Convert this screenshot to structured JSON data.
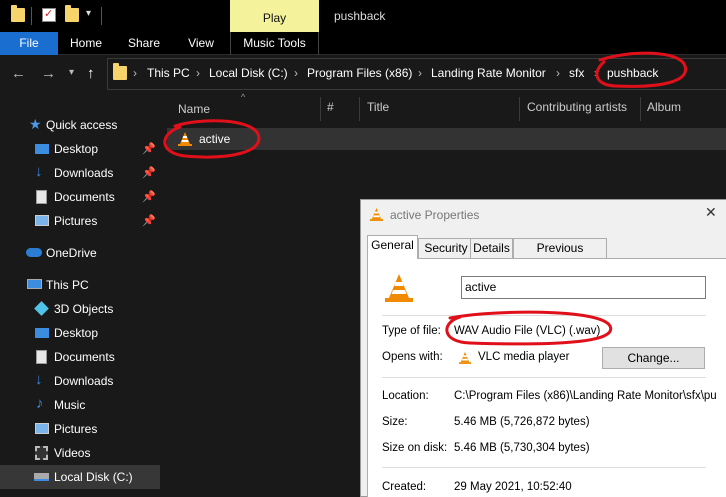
{
  "titlebar": {
    "context_tab": "Play",
    "window_title": "pushback"
  },
  "ribbon": {
    "tabs": [
      "File",
      "Home",
      "Share",
      "View",
      "Music Tools"
    ]
  },
  "address": {
    "crumbs": [
      "This PC",
      "Local Disk (C:)",
      "Program Files (x86)",
      "Landing Rate Monitor",
      "sfx",
      "pushback"
    ]
  },
  "navpane": {
    "quick_access": "Quick access",
    "quick_items": [
      "Desktop",
      "Downloads",
      "Documents",
      "Pictures"
    ],
    "onedrive": "OneDrive",
    "this_pc": "This PC",
    "pc_items": [
      "3D Objects",
      "Desktop",
      "Documents",
      "Downloads",
      "Music",
      "Pictures",
      "Videos",
      "Local Disk (C:)"
    ]
  },
  "filelist": {
    "columns": [
      "Name",
      "#",
      "Title",
      "Contributing artists",
      "Album"
    ],
    "files": [
      {
        "name": "active"
      }
    ]
  },
  "dialog": {
    "title": "active Properties",
    "close": "✕",
    "tabs": [
      "General",
      "Security",
      "Details",
      "Previous Versions"
    ],
    "name_value": "active",
    "type_label": "Type of file:",
    "type_value": "WAV Audio File (VLC) (.wav)",
    "opens_label": "Opens with:",
    "opens_value": "VLC media player",
    "change_button": "Change...",
    "location_label": "Location:",
    "location_value": "C:\\Program Files (x86)\\Landing Rate Monitor\\sfx\\pu",
    "size_label": "Size:",
    "size_value": "5.46 MB (5,726,872 bytes)",
    "size_disk_label": "Size on disk:",
    "size_disk_value": "5.46 MB (5,730,304 bytes)",
    "created_label": "Created:",
    "created_value": "29 May 2021, 10:52:40"
  },
  "colors": {
    "file_tab": "#1a6ed0",
    "play_context": "#f4f29b",
    "annotation_red": "#e0101a",
    "vlc_orange": "#f08a00"
  }
}
